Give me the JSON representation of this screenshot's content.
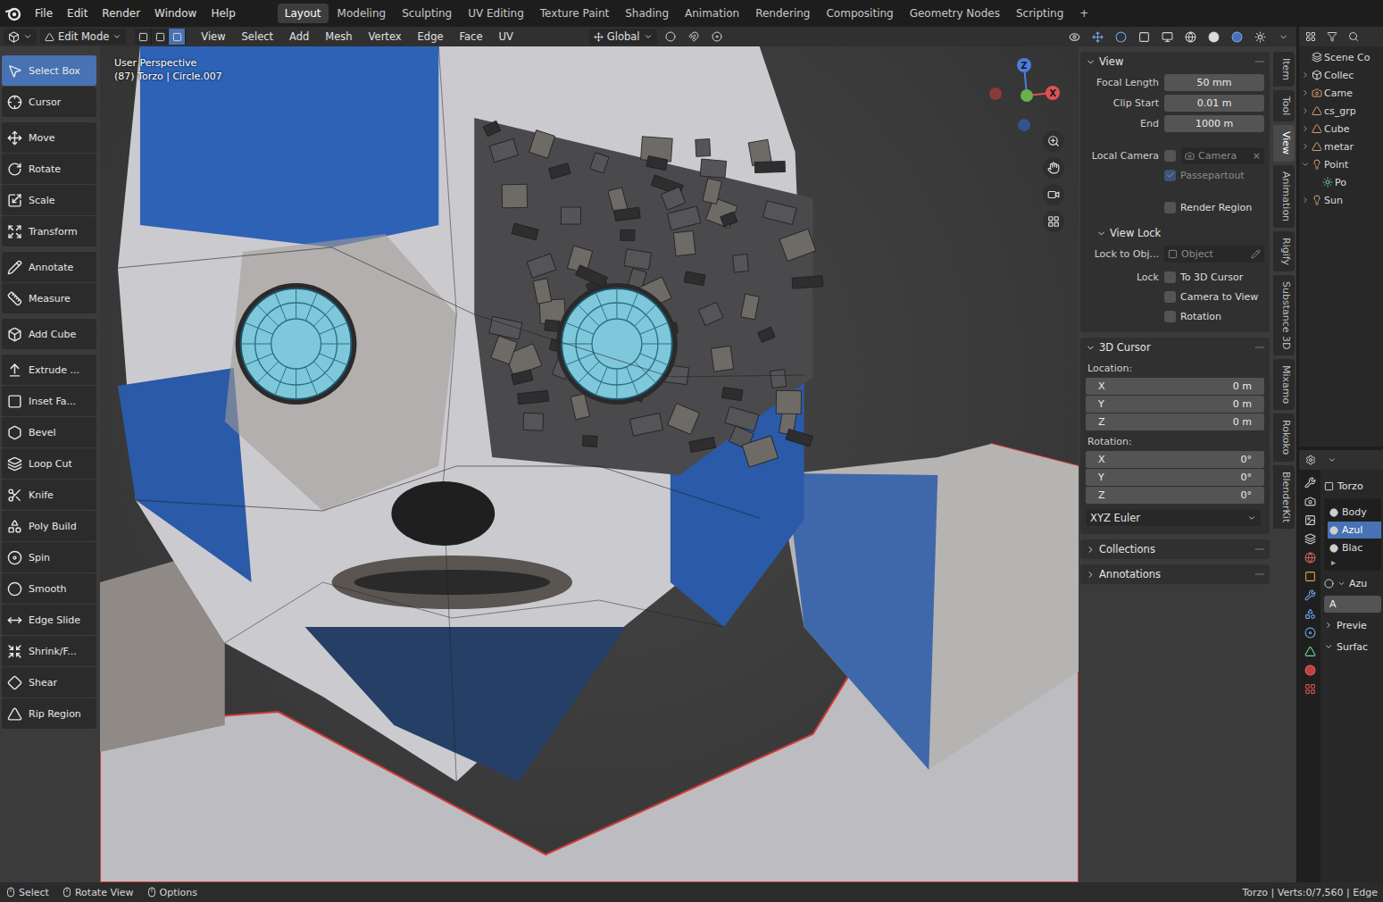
{
  "top_bar": {
    "menus": [
      "File",
      "Edit",
      "Render",
      "Window",
      "Help"
    ],
    "workspaces": [
      {
        "label": "Layout",
        "selected": true
      },
      {
        "label": "Modeling",
        "selected": false
      },
      {
        "label": "Sculpting",
        "selected": false
      },
      {
        "label": "UV Editing",
        "selected": false
      },
      {
        "label": "Texture Paint",
        "selected": false
      },
      {
        "label": "Shading",
        "selected": false
      },
      {
        "label": "Animation",
        "selected": false
      },
      {
        "label": "Rendering",
        "selected": false
      },
      {
        "label": "Compositing",
        "selected": false
      },
      {
        "label": "Geometry Nodes",
        "selected": false
      },
      {
        "label": "Scripting",
        "selected": false
      }
    ],
    "add_workspace": "+"
  },
  "header": {
    "mode": "Edit Mode",
    "select_modes": [
      {
        "selected": false
      },
      {
        "selected": false
      },
      {
        "selected": true
      }
    ],
    "menus": [
      "View",
      "Select",
      "Add",
      "Mesh",
      "Vertex",
      "Edge",
      "Face",
      "UV"
    ],
    "orientation": "Global"
  },
  "toolbar": {
    "groups": [
      [
        {
          "label": "Select Box",
          "selected": true
        },
        {
          "label": "Cursor",
          "selected": false
        }
      ],
      [
        {
          "label": "Move",
          "selected": false
        },
        {
          "label": "Rotate",
          "selected": false
        },
        {
          "label": "Scale",
          "selected": false
        },
        {
          "label": "Transform",
          "selected": false
        }
      ],
      [
        {
          "label": "Annotate",
          "selected": false
        },
        {
          "label": "Measure",
          "selected": false
        }
      ],
      [
        {
          "label": "Add Cube",
          "selected": false
        }
      ],
      [
        {
          "label": "Extrude ...",
          "selected": false
        },
        {
          "label": "Inset Fa...",
          "selected": false
        },
        {
          "label": "Bevel",
          "selected": false
        },
        {
          "label": "Loop Cut",
          "selected": false
        },
        {
          "label": "Knife",
          "selected": false
        },
        {
          "label": "Poly Build",
          "selected": false
        },
        {
          "label": "Spin",
          "selected": false
        },
        {
          "label": "Smooth",
          "selected": false
        },
        {
          "label": "Edge Slide",
          "selected": false
        },
        {
          "label": "Shrink/F...",
          "selected": false
        },
        {
          "label": "Shear",
          "selected": false
        },
        {
          "label": "Rip Region",
          "selected": false
        }
      ]
    ]
  },
  "viewport": {
    "view_name": "User Perspective",
    "object_info": "(87) Torzo | Circle.007",
    "gizmo": {
      "x": "X",
      "z": "Z"
    }
  },
  "n_panel": {
    "tabs": [
      {
        "label": "Item",
        "selected": false
      },
      {
        "label": "Tool",
        "selected": false
      },
      {
        "label": "View",
        "selected": true
      },
      {
        "label": "Animation",
        "selected": false
      },
      {
        "label": "Rigify",
        "selected": false
      },
      {
        "label": "Substance 3D",
        "selected": false
      },
      {
        "label": "Mixamo",
        "selected": false
      },
      {
        "label": "Rokoko",
        "selected": false
      },
      {
        "label": "BlenderKit",
        "selected": false
      }
    ],
    "view": {
      "title": "View",
      "expanded": true,
      "fields": [
        {
          "label": "Focal Length",
          "value": "50 mm"
        },
        {
          "label": "Clip Start",
          "value": "0.01 m"
        },
        {
          "label": "End",
          "value": "1000 m"
        }
      ],
      "local_camera": {
        "label": "Local Camera",
        "checked": false,
        "placeholder": "Camera",
        "clear": "×"
      },
      "passepartout": {
        "label": "Passepartout",
        "checked": true,
        "disabled": true
      },
      "render_region": {
        "label": "Render Region",
        "checked": false
      },
      "view_lock": {
        "title": "View Lock",
        "expanded": true,
        "lock_to_label": "Lock to Obj...",
        "lock_to_placeholder": "Object",
        "lock_label": "Lock",
        "locks": [
          {
            "label": "To 3D Cursor",
            "checked": false
          },
          {
            "label": "Camera to View",
            "checked": false
          },
          {
            "label": "Rotation",
            "checked": false
          }
        ]
      }
    },
    "cursor": {
      "title": "3D Cursor",
      "expanded": true,
      "location_label": "Location:",
      "location": [
        {
          "axis": "X",
          "value": "0 m"
        },
        {
          "axis": "Y",
          "value": "0 m"
        },
        {
          "axis": "Z",
          "value": "0 m"
        }
      ],
      "rotation_label": "Rotation:",
      "rotation": [
        {
          "axis": "X",
          "value": "0°"
        },
        {
          "axis": "Y",
          "value": "0°"
        },
        {
          "axis": "Z",
          "value": "0°"
        }
      ],
      "mode": "XYZ Euler"
    },
    "collapsed_panels": [
      {
        "title": "Collections",
        "expanded": false
      },
      {
        "title": "Annotations",
        "expanded": false
      }
    ]
  },
  "outliner": {
    "title": "Scene Co",
    "items": [
      {
        "label": "Collec",
        "kind": "collection",
        "expanded": false,
        "depth": 0
      },
      {
        "label": "Came",
        "kind": "camera",
        "expanded": false,
        "depth": 0
      },
      {
        "label": "cs_grp",
        "kind": "armature",
        "expanded": false,
        "depth": 0
      },
      {
        "label": "Cube",
        "kind": "mesh",
        "expanded": false,
        "depth": 0
      },
      {
        "label": "metar",
        "kind": "armature",
        "expanded": false,
        "depth": 0
      },
      {
        "label": "Point",
        "kind": "light",
        "expanded": true,
        "depth": 0
      },
      {
        "label": "Po",
        "kind": "light-data",
        "expanded": false,
        "depth": 1
      },
      {
        "label": "Sun",
        "kind": "light",
        "expanded": false,
        "depth": 0
      }
    ]
  },
  "properties": {
    "object": "Torzo",
    "slots": [
      {
        "label": "Body",
        "selected": false
      },
      {
        "label": "Azul",
        "selected": true
      },
      {
        "label": "Blac",
        "selected": false
      }
    ],
    "list_handle": "▸",
    "material": "Azu",
    "button": "A",
    "sections": [
      {
        "label": "Previe",
        "expanded": false
      },
      {
        "label": "Surfac",
        "expanded": true
      }
    ]
  },
  "status_bar": {
    "hints": [
      "Select",
      "Rotate View",
      "Options"
    ],
    "stats": "Torzo | Verts:0/7,560 | Edge"
  }
}
